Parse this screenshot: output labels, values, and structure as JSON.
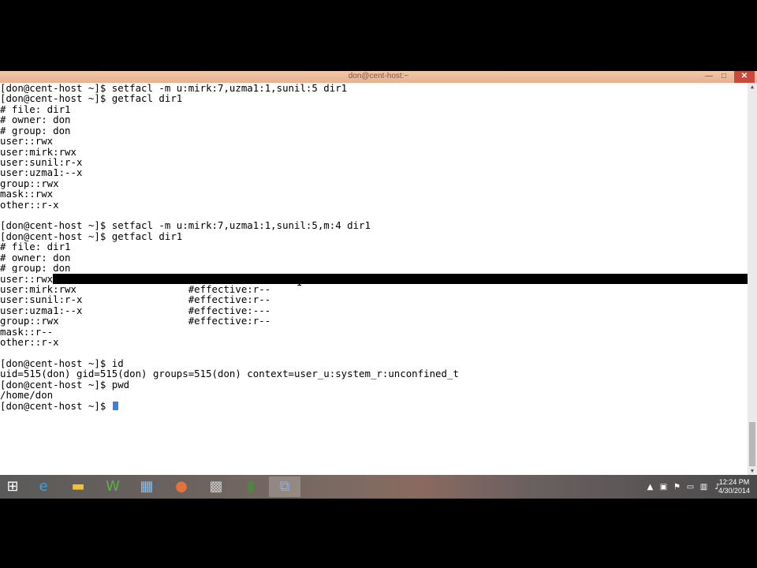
{
  "window": {
    "title": "don@cent-host:~"
  },
  "terminal": {
    "lines": [
      "[don@cent-host ~]$ setfacl -m u:mirk:7,uzma1:1,sunil:5 dir1",
      "[don@cent-host ~]$ getfacl dir1",
      "# file: dir1",
      "# owner: don",
      "# group: don",
      "user::rwx",
      "user:mirk:rwx",
      "user:sunil:r-x",
      "user:uzma1:--x",
      "group::rwx",
      "mask::rwx",
      "other::r-x",
      "",
      "[don@cent-host ~]$ setfacl -m u:mirk:7,uzma1:1,sunil:5,m:4 dir1",
      "[don@cent-host ~]$ getfacl dir1",
      "# file: dir1",
      "# owner: don",
      "# group: don",
      "user::rwx",
      "user:mirk:rwx                   #effective:r--",
      "user:sunil:r-x                  #effective:r--",
      "user:uzma1:--x                  #effective:---",
      "group::rwx                      #effective:r--",
      "mask::r--",
      "other::r-x",
      "",
      "[don@cent-host ~]$ id",
      "uid=515(don) gid=515(don) groups=515(don) context=user_u:system_r:unconfined_t",
      "[don@cent-host ~]$ pwd",
      "/home/don",
      "[don@cent-host ~]$ "
    ],
    "highlighted_line": 18
  },
  "taskbar": {
    "items": [
      {
        "name": "ie-icon",
        "glyph": "e",
        "color": "#3aa0e8"
      },
      {
        "name": "file-explorer-icon",
        "glyph": "▬",
        "color": "#f0c040"
      },
      {
        "name": "word-icon",
        "glyph": "W",
        "color": "#5ab04a"
      },
      {
        "name": "calculator-icon",
        "glyph": "▦",
        "color": "#8ac0e8"
      },
      {
        "name": "firefox-icon",
        "glyph": "●",
        "color": "#e8703a"
      },
      {
        "name": "app-icon",
        "glyph": "▩",
        "color": "#c8c8c8"
      },
      {
        "name": "notepad-icon",
        "glyph": "▮",
        "color": "#4a8a3a"
      },
      {
        "name": "putty-icon",
        "glyph": "⧉",
        "color": "#8ab0e8"
      }
    ],
    "clock_time": "12:24 PM",
    "clock_date": "4/30/2014"
  }
}
